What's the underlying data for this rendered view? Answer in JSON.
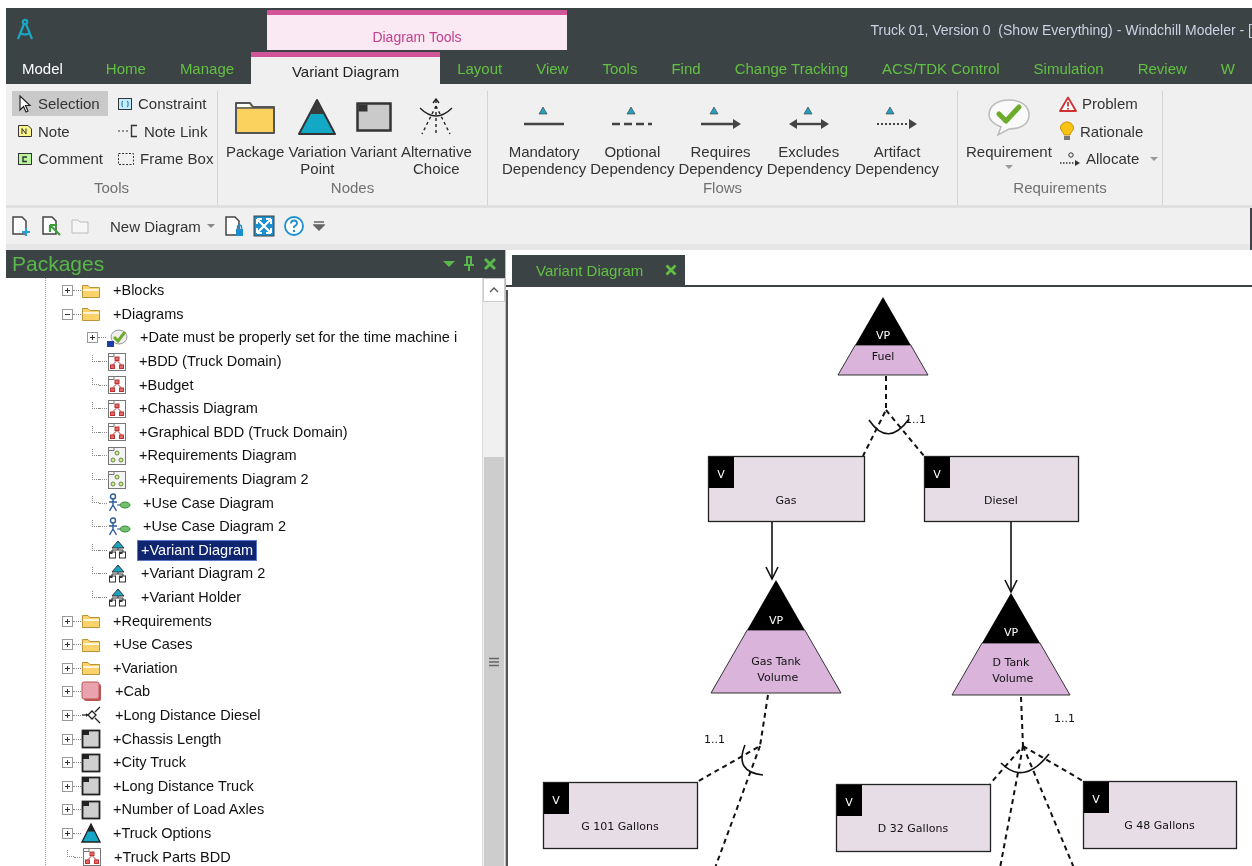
{
  "app": {
    "title": "Truck 01, Version 0  (Show Everything) - Windchill Modeler - [",
    "context_tab": "Diagram Tools"
  },
  "tabs": [
    {
      "label": "Model",
      "kind": "file",
      "selected": false
    },
    {
      "label": "Home",
      "kind": "normal",
      "selected": false
    },
    {
      "label": "Manage",
      "kind": "normal",
      "selected": false
    },
    {
      "label": "Variant Diagram",
      "kind": "context",
      "selected": true
    },
    {
      "label": "Layout",
      "kind": "normal",
      "selected": false
    },
    {
      "label": "View",
      "kind": "normal",
      "selected": false
    },
    {
      "label": "Tools",
      "kind": "normal",
      "selected": false
    },
    {
      "label": "Find",
      "kind": "normal",
      "selected": false
    },
    {
      "label": "Change Tracking",
      "kind": "normal",
      "selected": false
    },
    {
      "label": "ACS/TDK Control",
      "kind": "normal",
      "selected": false
    },
    {
      "label": "Simulation",
      "kind": "normal",
      "selected": false
    },
    {
      "label": "Review",
      "kind": "normal",
      "selected": false
    },
    {
      "label": "W",
      "kind": "normal",
      "selected": false
    }
  ],
  "ribbon": {
    "groups": [
      {
        "label": "Tools",
        "items": [
          {
            "label": "Selection",
            "kind": "small",
            "selected": true
          },
          {
            "label": "Constraint",
            "kind": "small",
            "selected": false
          },
          {
            "label": "Note",
            "kind": "small",
            "selected": false
          },
          {
            "label": "Note Link",
            "kind": "small",
            "selected": false
          },
          {
            "label": "Comment",
            "kind": "small",
            "selected": false
          },
          {
            "label": "Frame Box",
            "kind": "small",
            "selected": false
          }
        ]
      },
      {
        "label": "Nodes",
        "items": [
          {
            "label": "Package",
            "kind": "large"
          },
          {
            "label": "Variation Point",
            "kind": "large"
          },
          {
            "label": "Variant",
            "kind": "large"
          },
          {
            "label": "Alternative Choice",
            "kind": "large"
          }
        ]
      },
      {
        "label": "Flows",
        "items": [
          {
            "label": "Mandatory Dependency",
            "kind": "large"
          },
          {
            "label": "Optional Dependency",
            "kind": "large"
          },
          {
            "label": "Requires Dependency",
            "kind": "large"
          },
          {
            "label": "Excludes Dependency",
            "kind": "large"
          },
          {
            "label": "Artifact Dependency",
            "kind": "large"
          }
        ]
      },
      {
        "label": "Requirements",
        "items": [
          {
            "label": "Requirement",
            "kind": "large",
            "dropdown": true
          },
          {
            "label": "Problem",
            "kind": "small",
            "dropdown": false
          },
          {
            "label": "Rationale",
            "kind": "small",
            "dropdown": false
          },
          {
            "label": "Allocate",
            "kind": "small",
            "dropdown": true
          }
        ]
      }
    ]
  },
  "quick_toolbar": {
    "new_diagram": "New Diagram"
  },
  "packages": {
    "title": "Packages",
    "tree": [
      {
        "label": "+Blocks",
        "kind": "package",
        "has_children": true,
        "expanded": false,
        "selected": false
      },
      {
        "label": "+Diagrams",
        "kind": "package",
        "has_children": true,
        "expanded": true,
        "selected": false,
        "children": [
          {
            "label": "+Date must be properly set for the time machine i",
            "kind": "requirement",
            "has_children": true,
            "expanded": false,
            "selected": false
          },
          {
            "label": "+BDD (Truck Domain)",
            "kind": "bdd",
            "has_children": false,
            "selected": false
          },
          {
            "label": "+Budget",
            "kind": "bdd",
            "has_children": false,
            "selected": false
          },
          {
            "label": "+Chassis Diagram",
            "kind": "bdd",
            "has_children": false,
            "selected": false
          },
          {
            "label": "+Graphical BDD (Truck Domain)",
            "kind": "bdd",
            "has_children": false,
            "selected": false
          },
          {
            "label": "+Requirements Diagram",
            "kind": "requirements_diagram",
            "has_children": false,
            "selected": false
          },
          {
            "label": "+Requirements Diagram 2",
            "kind": "requirements_diagram",
            "has_children": false,
            "selected": false
          },
          {
            "label": "+Use Case Diagram",
            "kind": "use_case_diagram",
            "has_children": false,
            "selected": false
          },
          {
            "label": "+Use Case Diagram 2",
            "kind": "use_case_diagram",
            "has_children": false,
            "selected": false
          },
          {
            "label": "+Variant Diagram",
            "kind": "variant_diagram",
            "has_children": false,
            "selected": true
          },
          {
            "label": "+Variant Diagram 2",
            "kind": "variant_diagram",
            "has_children": false,
            "selected": false
          },
          {
            "label": "+Variant Holder",
            "kind": "variant_diagram",
            "has_children": false,
            "selected": false
          }
        ]
      },
      {
        "label": "+Requirements",
        "kind": "package",
        "has_children": true,
        "expanded": false,
        "selected": false
      },
      {
        "label": "+Use Cases",
        "kind": "package",
        "has_children": true,
        "expanded": false,
        "selected": false
      },
      {
        "label": "+Variation",
        "kind": "package",
        "has_children": true,
        "expanded": false,
        "selected": false
      },
      {
        "label": "+Cab",
        "kind": "block",
        "has_children": true,
        "expanded": false,
        "selected": false
      },
      {
        "label": "+Long Distance Diesel",
        "kind": "variation",
        "has_children": true,
        "expanded": false,
        "selected": false
      },
      {
        "label": "+Chassis Length",
        "kind": "variant",
        "has_children": true,
        "expanded": false,
        "selected": false
      },
      {
        "label": "+City Truck",
        "kind": "variant",
        "has_children": true,
        "expanded": false,
        "selected": false
      },
      {
        "label": "+Long Distance Truck",
        "kind": "variant",
        "has_children": true,
        "expanded": false,
        "selected": false
      },
      {
        "label": "+Number of Load Axles",
        "kind": "variant",
        "has_children": true,
        "expanded": false,
        "selected": false
      },
      {
        "label": "+Truck Options",
        "kind": "variation_point",
        "has_children": true,
        "expanded": false,
        "selected": false
      },
      {
        "label": "+Truck Parts BDD",
        "kind": "bdd",
        "has_children": false,
        "selected": false
      }
    ]
  },
  "diagram": {
    "tab": "Variant Diagram",
    "nodes": [
      {
        "kind": "variation_point",
        "stereotype": "VP",
        "label": "Fuel"
      },
      {
        "kind": "variant",
        "stereotype": "V",
        "label": "Gas"
      },
      {
        "kind": "variant",
        "stereotype": "V",
        "label": "Diesel"
      },
      {
        "kind": "variation_point",
        "stereotype": "VP",
        "label": "Gas Tank Volume"
      },
      {
        "kind": "variation_point",
        "stereotype": "VP",
        "label": "D Tank Volume"
      },
      {
        "kind": "variant",
        "stereotype": "V",
        "label": "G 101 Gallons"
      },
      {
        "kind": "variant",
        "stereotype": "V",
        "label": "D 32 Gallons"
      },
      {
        "kind": "variant",
        "stereotype": "V",
        "label": "G 48 Gallons"
      }
    ],
    "multiplicities": [
      "1..1",
      "1..1",
      "1..1"
    ]
  }
}
